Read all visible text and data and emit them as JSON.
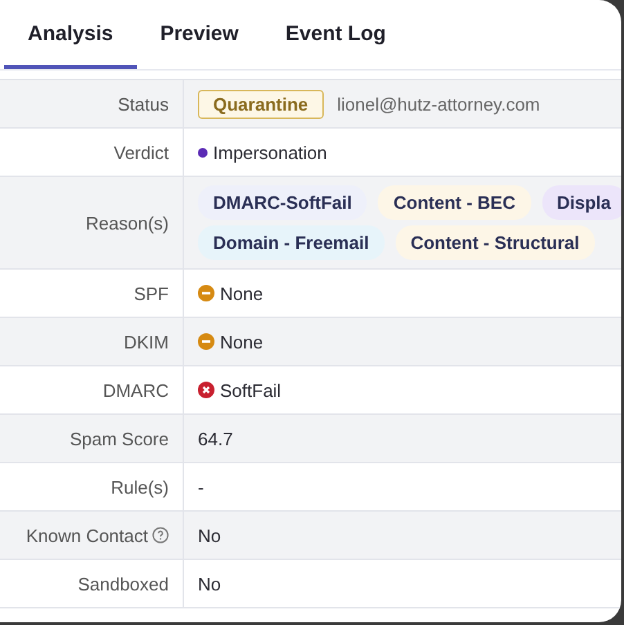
{
  "tabs": [
    {
      "label": "Analysis",
      "selected": true
    },
    {
      "label": "Preview",
      "selected": false
    },
    {
      "label": "Event Log",
      "selected": false
    }
  ],
  "rows": [
    {
      "label": "Status",
      "kind": "status",
      "badge": "Quarantine",
      "value": "lionel@hutz-attorney.com"
    },
    {
      "label": "Verdict",
      "kind": "verdict",
      "color": "#5b2bb5",
      "value": "Impersonation"
    },
    {
      "label": "Reason(s)",
      "kind": "tags",
      "tag_lines": [
        [
          {
            "text": "DMARC-SoftFail",
            "color": "#eef0fa"
          },
          {
            "text": "Content - BEC",
            "color": "#fdf6e7"
          },
          {
            "text": "Displa",
            "color": "#ece5fa"
          }
        ],
        [
          {
            "text": "Domain - Freemail",
            "color": "#e7f4fa"
          },
          {
            "text": "Content - Structural",
            "color": "#fdf6e7"
          }
        ]
      ]
    },
    {
      "label": "SPF",
      "kind": "neutral",
      "value": "None"
    },
    {
      "label": "DKIM",
      "kind": "neutral",
      "value": "None"
    },
    {
      "label": "DMARC",
      "kind": "failed",
      "value": "SoftFail"
    },
    {
      "label": "Spam Score",
      "kind": "text",
      "value": "64.7"
    },
    {
      "label": "Rule(s)",
      "kind": "text",
      "value": "-"
    },
    {
      "label": "Known Contact",
      "kind": "text",
      "help": true,
      "value": "No"
    },
    {
      "label": "Sandboxed",
      "kind": "text",
      "value": "No"
    }
  ]
}
